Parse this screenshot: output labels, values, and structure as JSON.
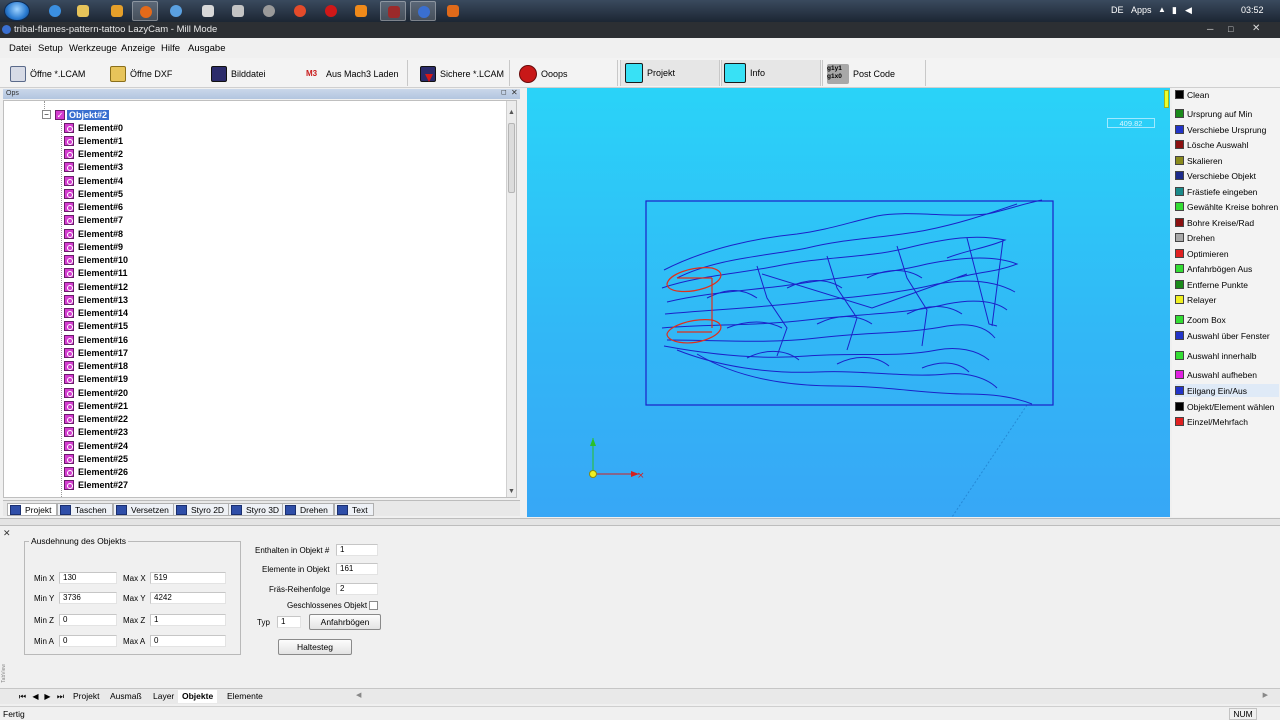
{
  "taskbar": {
    "language": "DE",
    "apps_label": "Apps",
    "clock": "03:52"
  },
  "window": {
    "title": "tribal-flames-pattern-tattoo LazyCam - Mill Mode"
  },
  "menu": [
    "Datei",
    "Setup",
    "Werkzeuge",
    "Anzeige",
    "Hilfe",
    "Ausgabe"
  ],
  "toolbar": {
    "open_lcam": "Öffne *.LCAM",
    "open_dxf": "Öffne DXF",
    "image_file": "Bilddatei",
    "from_mach3": "Aus Mach3 Laden",
    "save_lcam": "Sichere *.LCAM",
    "oops": "Ooops",
    "project": "Projekt",
    "info": "Info",
    "post_code": "Post Code",
    "post_code_icon_text": "g1y1\ng1x0"
  },
  "ops_panel": {
    "header": "Ops",
    "root_label": "Objekt#2",
    "elements": [
      "Element#0",
      "Element#1",
      "Element#2",
      "Element#3",
      "Element#4",
      "Element#5",
      "Element#6",
      "Element#7",
      "Element#8",
      "Element#9",
      "Element#10",
      "Element#11",
      "Element#12",
      "Element#13",
      "Element#14",
      "Element#15",
      "Element#16",
      "Element#17",
      "Element#18",
      "Element#19",
      "Element#20",
      "Element#21",
      "Element#22",
      "Element#23",
      "Element#24",
      "Element#25",
      "Element#26",
      "Element#27"
    ],
    "tabs": [
      "Projekt",
      "Taschen",
      "Versetzen",
      "Styro 2D",
      "Styro 3D",
      "Drehen",
      "Text"
    ]
  },
  "viewport": {
    "coord_readout": "409.82"
  },
  "right_panel": {
    "items": [
      {
        "label": "Clean",
        "color": "#000000"
      },
      {
        "label": "Ursprung auf Min",
        "color": "#1a8a1a"
      },
      {
        "label": "Verschiebe Ursprung",
        "color": "#2234c8"
      },
      {
        "label": "Lösche Auswahl",
        "color": "#8b1010"
      },
      {
        "label": "Skalieren",
        "color": "#8a8a1c"
      },
      {
        "label": "Verschiebe Objekt",
        "color": "#1c2a8a"
      },
      {
        "label": "Frästiefe eingeben",
        "color": "#1a8a8a"
      },
      {
        "label": "Gewählte Kreise bohren",
        "color": "#33dd33"
      },
      {
        "label": "Bohre Kreise/Rad",
        "color": "#8b1010"
      },
      {
        "label": "Drehen",
        "color": "#a8a8a8"
      },
      {
        "label": "Optimieren",
        "color": "#e02020"
      },
      {
        "label": "Anfahrbögen Aus",
        "color": "#33dd33"
      },
      {
        "label": "Entferne Punkte",
        "color": "#1a8a1a"
      },
      {
        "label": "Relayer",
        "color": "#f0f020"
      },
      {
        "label": "Zoom Box",
        "color": "#33dd33"
      },
      {
        "label": "Auswahl über Fenster",
        "color": "#2234c8"
      },
      {
        "label": "Auswahl innerhalb",
        "color": "#33dd33"
      },
      {
        "label": "Auswahl aufheben",
        "color": "#e020e0"
      },
      {
        "label": "Eilgang Ein/Aus",
        "color": "#2234c8"
      },
      {
        "label": "Objekt/Element wählen",
        "color": "#000000"
      },
      {
        "label": "Einzel/Mehrfach",
        "color": "#e02020"
      }
    ]
  },
  "object_extent": {
    "legend": "Ausdehnung des Objekts",
    "min_x_label": "Min X",
    "min_x": "130",
    "max_x_label": "Max X",
    "max_x": "519",
    "min_y_label": "Min Y",
    "min_y": "3736",
    "max_y_label": "Max Y",
    "max_y": "4242",
    "min_z_label": "Min Z",
    "min_z": "0",
    "max_z_label": "Max Z",
    "max_z": "1",
    "min_a_label": "Min A",
    "min_a": "0",
    "max_a_label": "Max A",
    "max_a": "0"
  },
  "object_info": {
    "contained_label": "Enthalten in Objekt #",
    "contained": "1",
    "elements_label": "Elemente in Objekt",
    "elements": "161",
    "order_label": "Fräs-Reihenfolge",
    "order": "2",
    "closed_label": "Geschlossenes Objekt",
    "type_label": "Typ",
    "type": "1",
    "leadin_button": "Anfahrbögen",
    "tab_button": "Haltesteg"
  },
  "bottom_tabs": [
    "Projekt",
    "Ausmaß",
    "Layer",
    "Objekte",
    "Elemente"
  ],
  "bottom_active_tab": "Objekte",
  "side_label": "TabView",
  "status": {
    "text": "Fertig",
    "num": "NUM"
  }
}
